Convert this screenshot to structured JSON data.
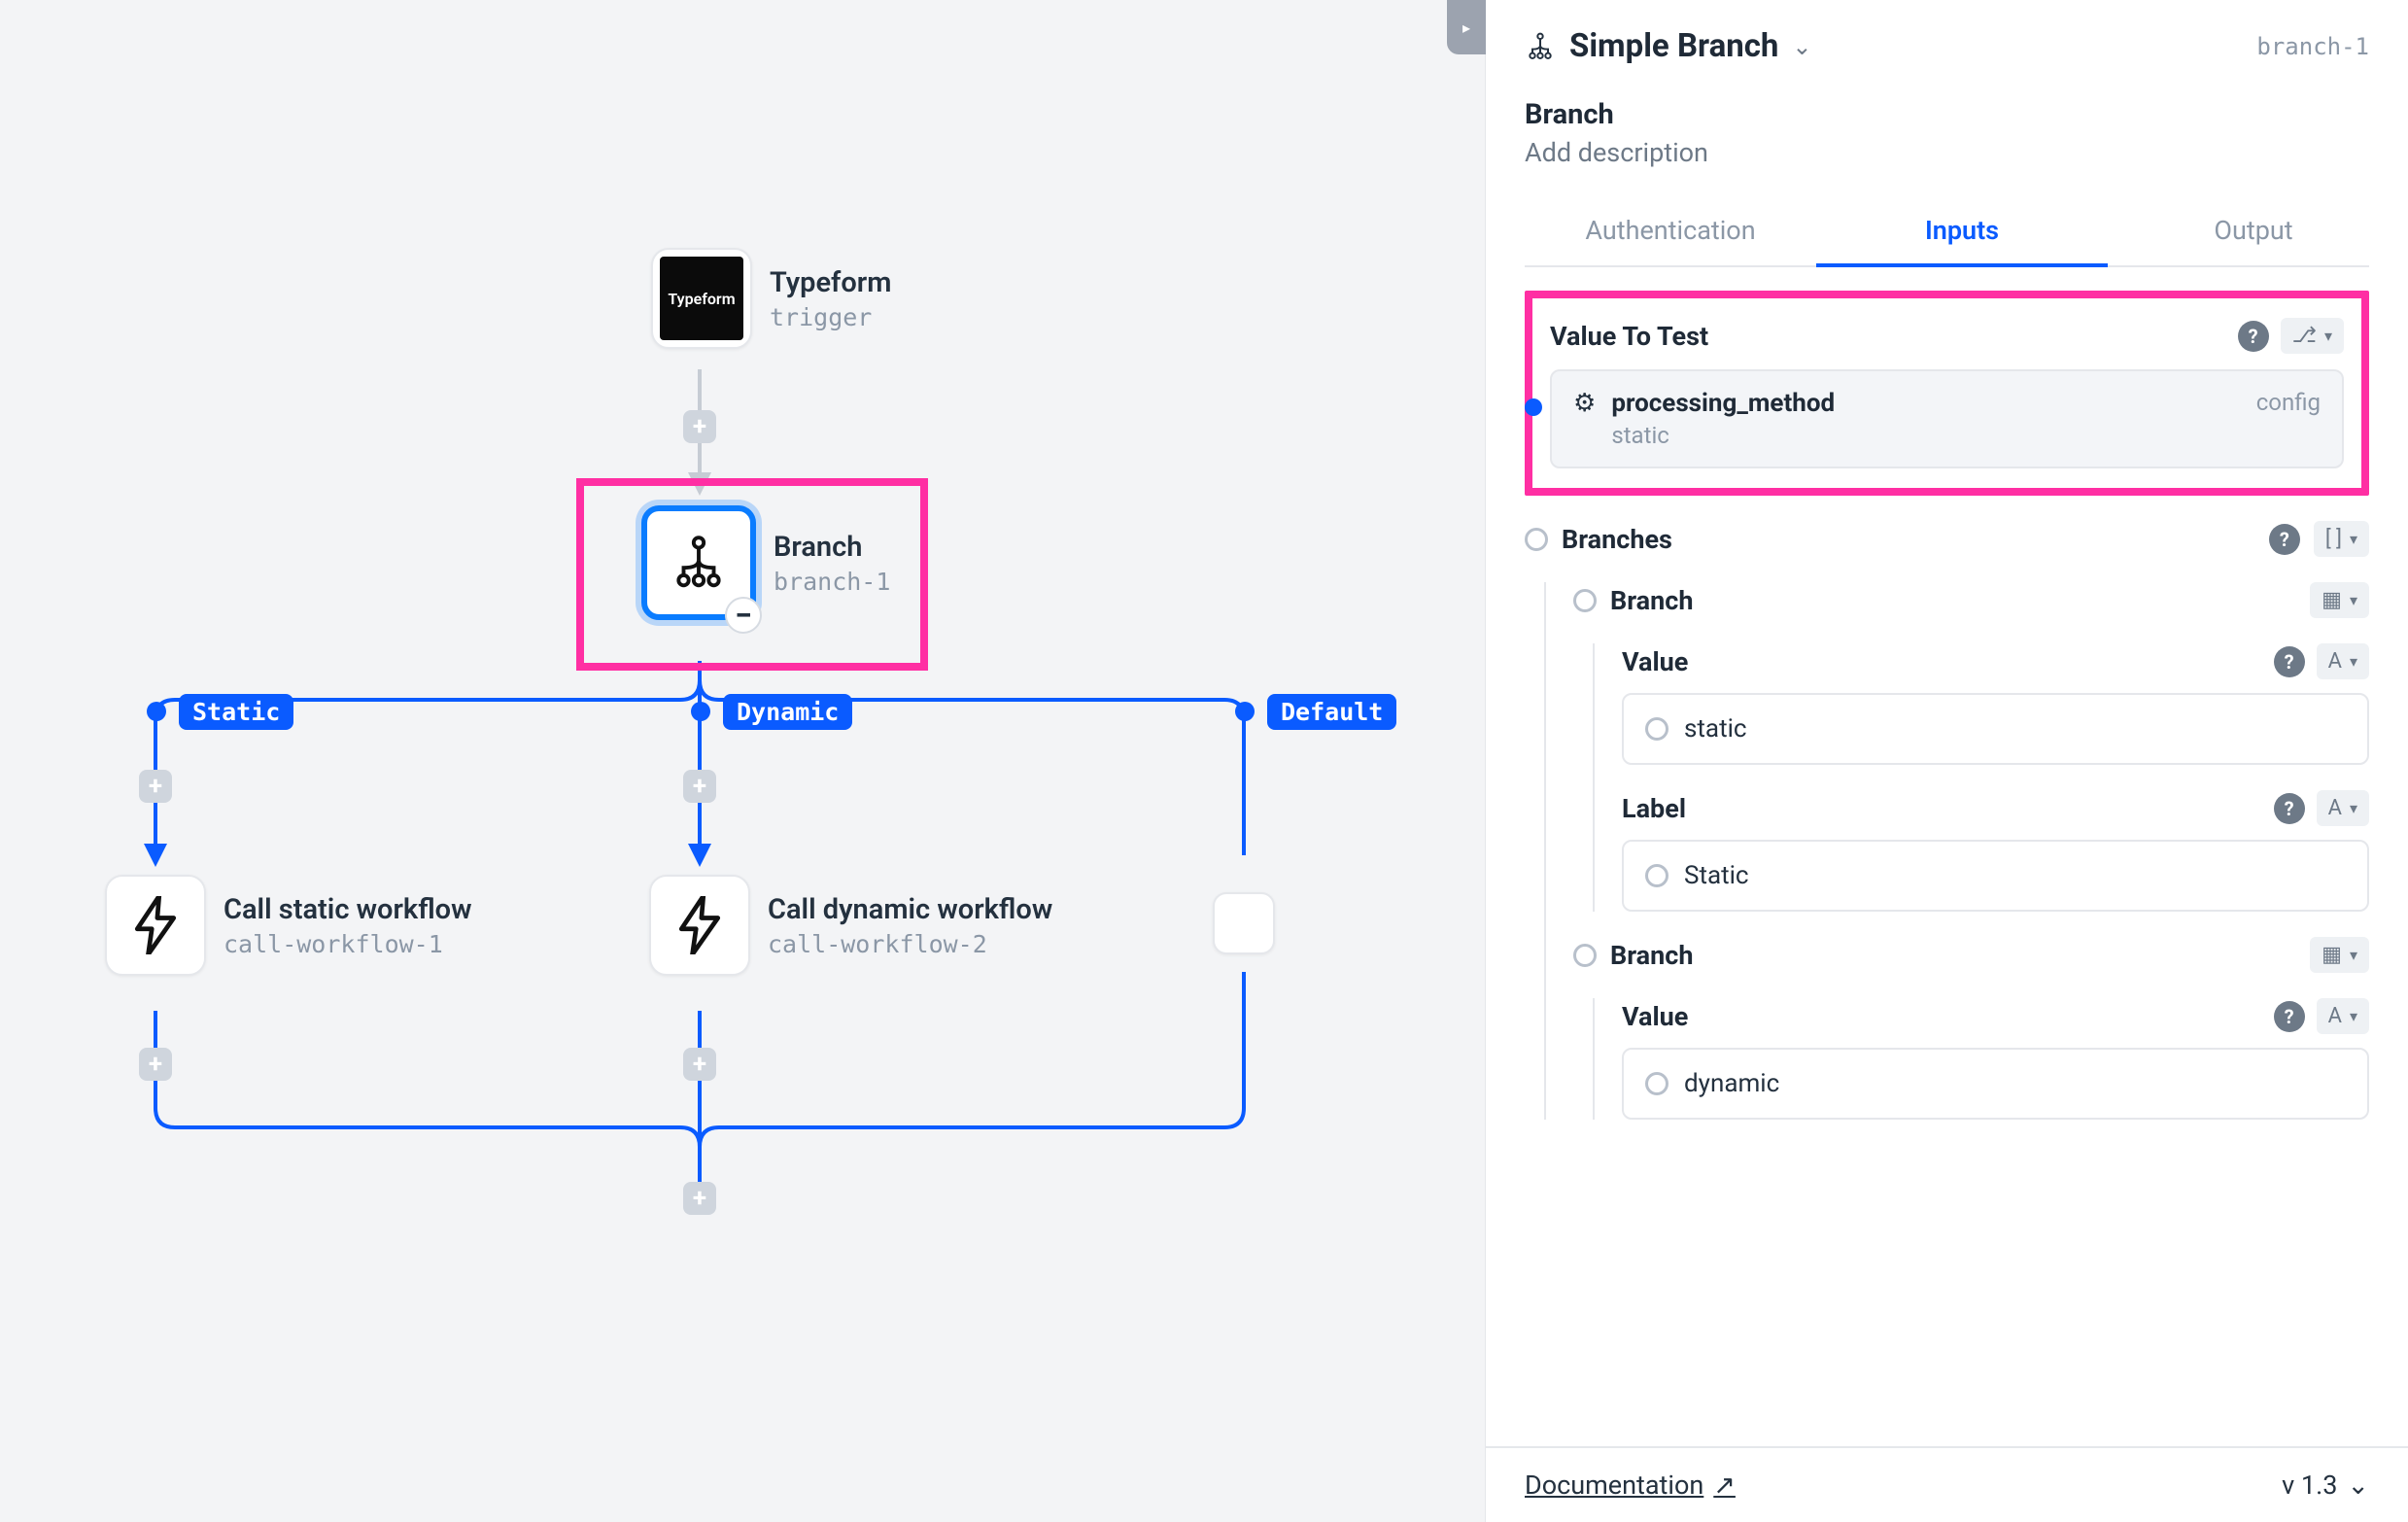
{
  "canvas": {
    "nodes": {
      "typeform": {
        "title": "Typeform",
        "sub": "trigger",
        "logo": "Typeform"
      },
      "branch": {
        "title": "Branch",
        "sub": "branch-1"
      },
      "static": {
        "title": "Call static workflow",
        "sub": "call-workflow-1"
      },
      "dynamic": {
        "title": "Call dynamic workflow",
        "sub": "call-workflow-2"
      }
    },
    "labels": {
      "static": "Static",
      "dynamic": "Dynamic",
      "default": "Default"
    }
  },
  "sidebar": {
    "icon": "branch",
    "title": "Simple Branch",
    "id": "branch-1",
    "name": "Branch",
    "description_placeholder": "Add description",
    "tabs": {
      "auth": "Authentication",
      "inputs": "Inputs",
      "output": "Output",
      "active": "inputs"
    },
    "value_to_test": {
      "label": "Value To Test",
      "item_title": "processing_method",
      "item_sub": "static",
      "item_tag": "config",
      "type_glyph": "⎇"
    },
    "branches": {
      "label": "Branches",
      "type_glyph": "[ ]",
      "items": [
        {
          "label": "Branch",
          "item_glyph": "▦",
          "fields": [
            {
              "name": "Value",
              "glyph": "A",
              "val": "static"
            },
            {
              "name": "Label",
              "glyph": "A",
              "val": "Static"
            }
          ]
        },
        {
          "label": "Branch",
          "item_glyph": "▦",
          "fields": [
            {
              "name": "Value",
              "glyph": "A",
              "val": "dynamic"
            }
          ]
        }
      ]
    },
    "footer": {
      "doc": "Documentation",
      "version": "v 1.3"
    }
  }
}
